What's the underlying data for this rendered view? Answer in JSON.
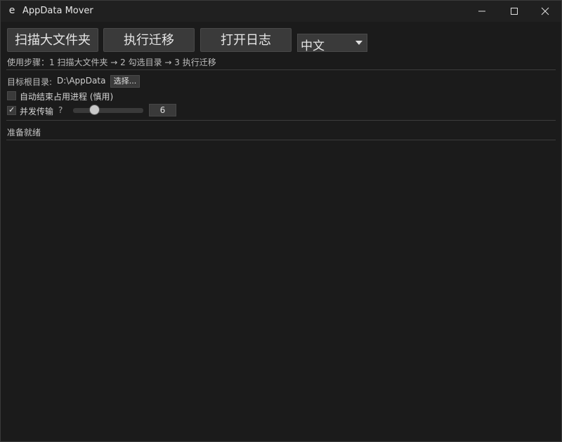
{
  "window": {
    "title": "AppData Mover",
    "icon_glyph": "e",
    "icon": "app-e-icon"
  },
  "toolbar": {
    "scan_label": "扫描大文件夹",
    "migrate_label": "执行迁移",
    "open_log_label": "打开日志",
    "language_selected": "中文"
  },
  "steps": {
    "text": "使用步骤：1 扫描大文件夹 → 2 勾选目录 → 3 执行迁移"
  },
  "target": {
    "label": "目标根目录:",
    "path": "D:\\AppData",
    "choose_label": "选择..."
  },
  "options": {
    "auto_kill_label": "自动结束占用进程 (慎用)",
    "auto_kill_checked": false,
    "concurrent_label": "并发传输",
    "concurrent_checked": true,
    "check_glyph": "✓",
    "help_glyph": "?",
    "concurrency_value": "6",
    "concurrency_level_fraction": 0.3
  },
  "status": {
    "text": "准备就绪"
  },
  "colors": {
    "background": "#1b1b1b",
    "button": "#3a3a3a",
    "text": "#d9d9d9"
  }
}
